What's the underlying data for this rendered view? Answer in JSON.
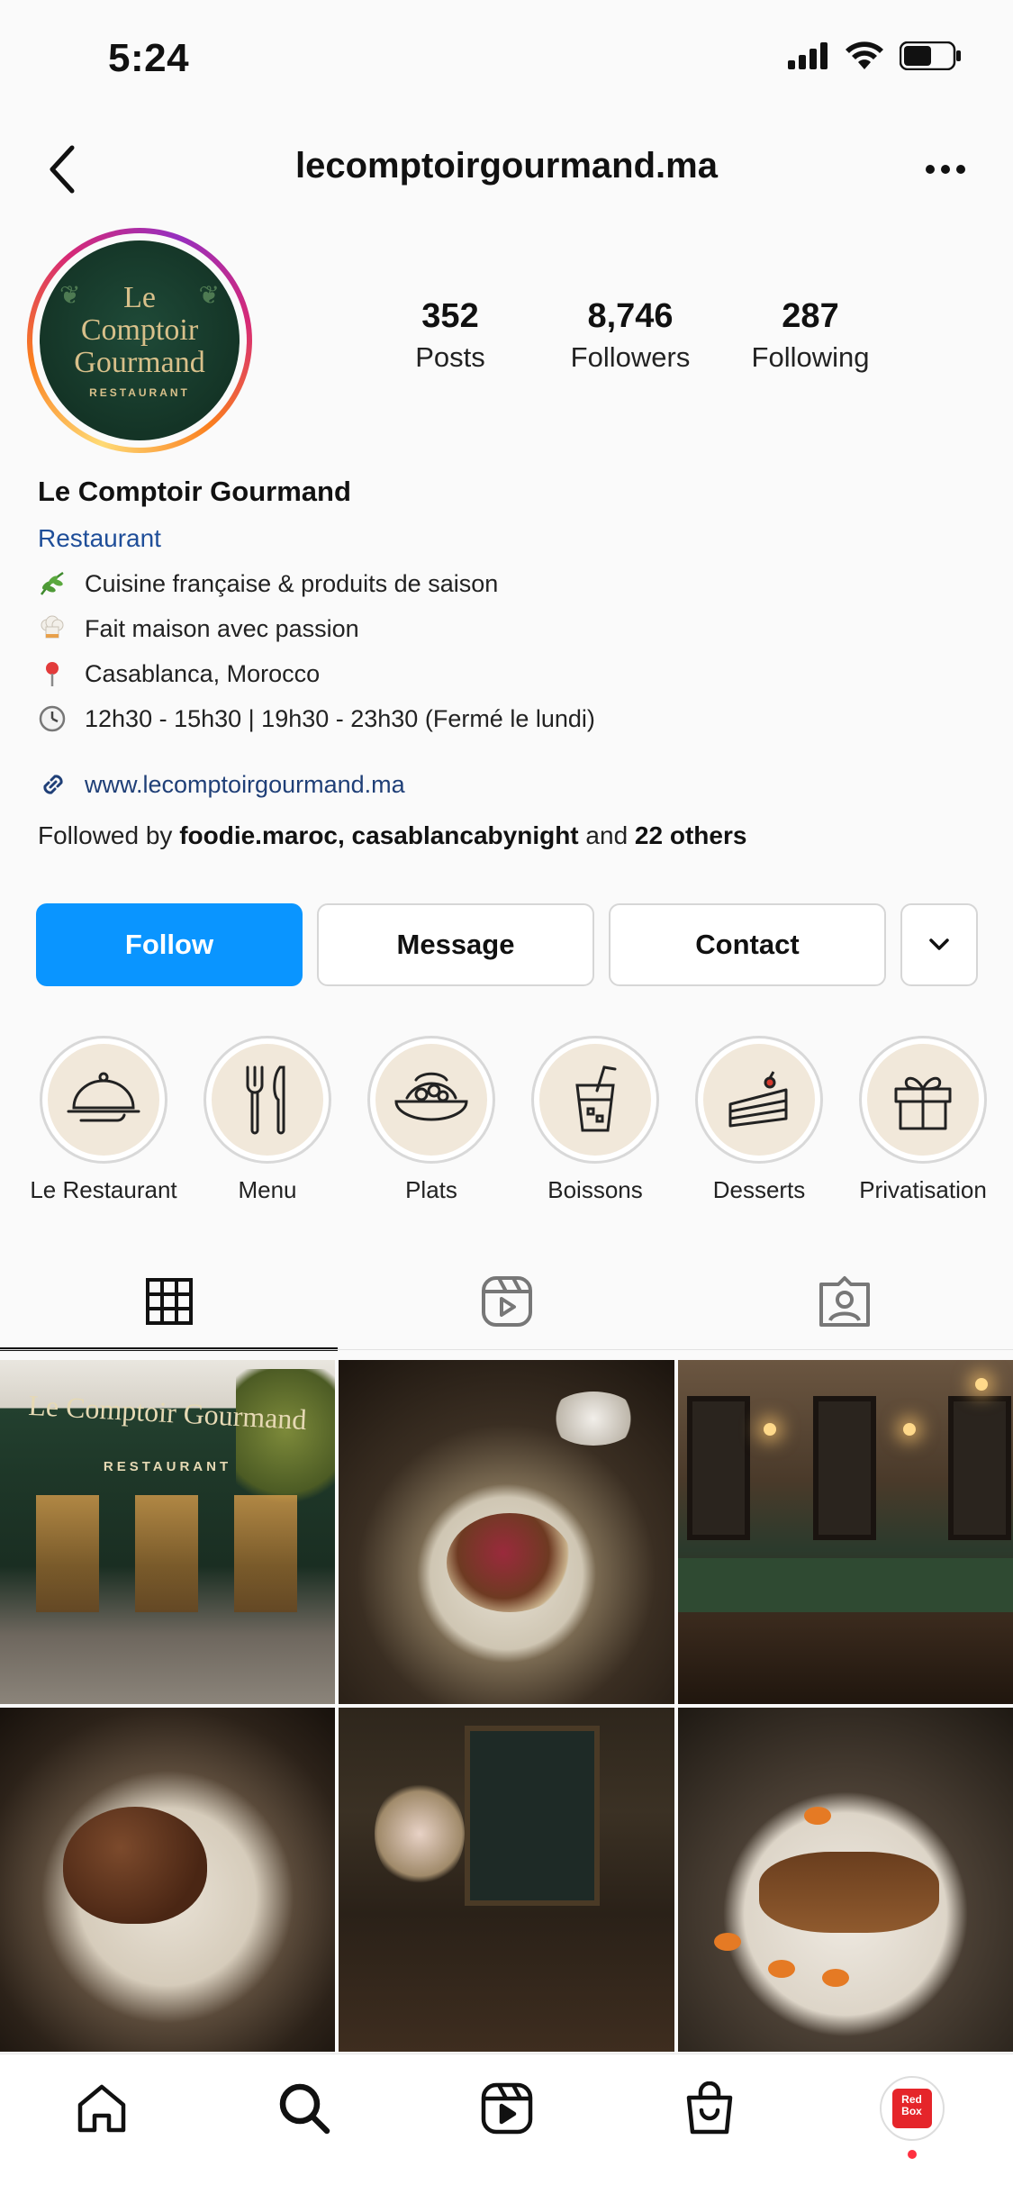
{
  "status_bar": {
    "time": "5:24"
  },
  "header": {
    "username": "lecomptoirgourmand.ma"
  },
  "avatar": {
    "line1": "Le",
    "line2": "Comptoir",
    "line3": "Gourmand",
    "line4": "RESTAURANT"
  },
  "stats": [
    {
      "value": "352",
      "label": "Posts"
    },
    {
      "value": "8,746",
      "label": "Followers"
    },
    {
      "value": "287",
      "label": "Following"
    }
  ],
  "bio": {
    "name": "Le Comptoir Gourmand",
    "category": "Restaurant",
    "lines": [
      {
        "icon": "herb-icon",
        "text": "Cuisine française & produits de saison"
      },
      {
        "icon": "chef-hat-icon",
        "text": "Fait maison avec passion"
      },
      {
        "icon": "pin-icon",
        "text": "Casablanca, Morocco"
      },
      {
        "icon": "clock-icon",
        "text": "12h30 - 15h30 | 19h30 - 23h30 (Fermé le lundi)"
      }
    ],
    "link": "www.lecomptoirgourmand.ma",
    "followed_prefix": "Followed by ",
    "followed_names": "foodie.maroc, casablancabynight",
    "followed_and": " and ",
    "followed_others": "22 others"
  },
  "actions": {
    "follow": "Follow",
    "message": "Message",
    "contact": "Contact"
  },
  "highlights": [
    {
      "label": "Le Restaurant",
      "icon": "cloche-icon"
    },
    {
      "label": "Menu",
      "icon": "cutlery-icon"
    },
    {
      "label": "Plats",
      "icon": "dish-icon"
    },
    {
      "label": "Boissons",
      "icon": "drink-icon"
    },
    {
      "label": "Desserts",
      "icon": "cake-icon"
    },
    {
      "label": "Privatisation",
      "icon": "gift-icon"
    }
  ],
  "grid_posts": {
    "post1": {
      "sign": "Le Comptoir Gourmand",
      "subsign": "RESTAURANT"
    }
  },
  "bottom_nav": {
    "badge_line1": "Red",
    "badge_line2": "Box"
  },
  "colors": {
    "follow_button": "#0a95ff",
    "category_link": "#1f4e99",
    "highlight_bg": "#f1e8da"
  }
}
